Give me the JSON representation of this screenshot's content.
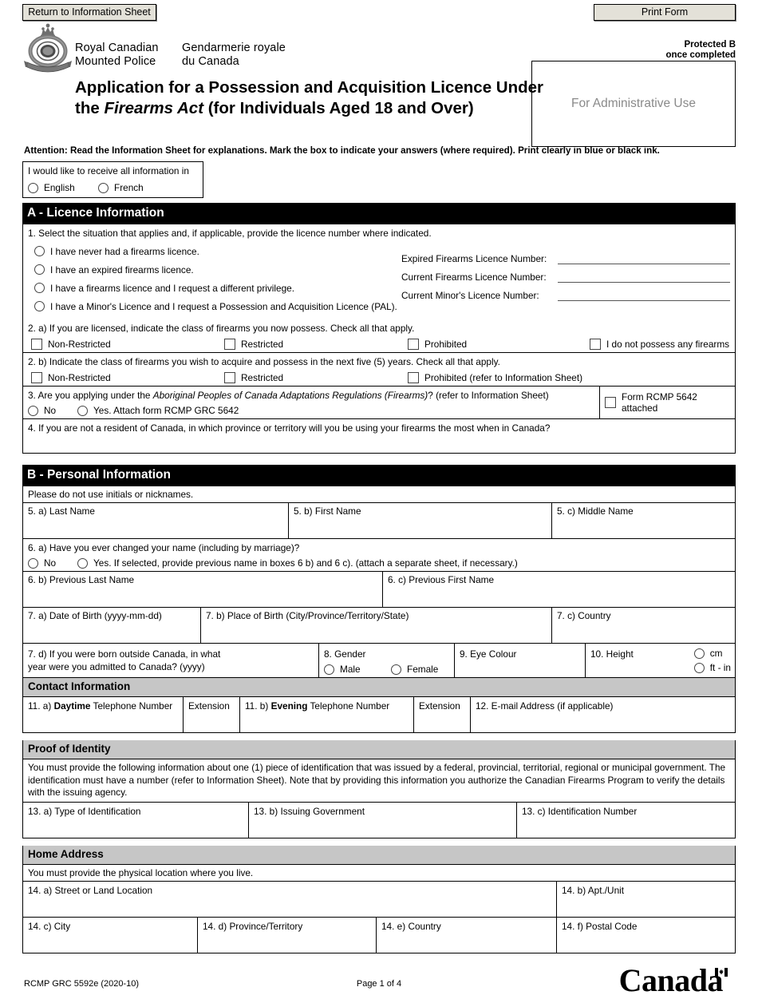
{
  "buttons": {
    "return_label": "Return to Information Sheet",
    "print_label": "Print Form"
  },
  "header": {
    "org_en_line1": "Royal Canadian",
    "org_en_line2": "Mounted Police",
    "org_fr_line1": "Gendarmerie royale",
    "org_fr_line2": "du Canada",
    "title_part1": "Application for a Possession and Acquisition Licence Under the ",
    "title_italic": "Firearms Act",
    "title_part2": " (for Individuals Aged 18 and Over)",
    "protected_line1": "Protected B",
    "protected_line2": "once completed",
    "admin_use": "For Administrative Use"
  },
  "attention": "Attention: Read the Information Sheet for explanations. Mark the box to indicate your answers (where required). Print clearly in blue or black ink.",
  "language": {
    "prompt": "I would like to receive all information in",
    "option_english": "English",
    "option_french": "French"
  },
  "section_a": {
    "heading": "A - Licence Information",
    "q1": {
      "lead": "1. Select the situation that applies and, if applicable, provide the licence number where indicated.",
      "choices": [
        "I have never had a firearms licence.",
        "I have an expired firearms licence.",
        "I have a firearms licence and I request a different privilege.",
        "I have a Minor's Licence and I request a Possession and Acquisition Licence (PAL)."
      ],
      "number_labels": [
        "Expired Firearms Licence Number:",
        "Current Firearms Licence Number:",
        "Current Minor's Licence Number:"
      ]
    },
    "q2a": {
      "lead": "2. a) If you are licensed, indicate the class of firearms you now possess. Check all that apply.",
      "options": [
        "Non-Restricted",
        "Restricted",
        "Prohibited",
        "I do not possess any firearms"
      ]
    },
    "q2b": {
      "lead": "2. b) Indicate the class of firearms you wish to acquire and possess in the next five (5) years. Check all that apply.",
      "options": [
        "Non-Restricted",
        "Restricted",
        "Prohibited (refer to Information Sheet)"
      ]
    },
    "q3": {
      "lead_part1": "3. Are you applying under the ",
      "lead_italic": "Aboriginal Peoples of Canada Adaptations Regulations (Firearms)",
      "lead_part2": "? (refer to Information Sheet)",
      "option_no": "No",
      "option_yes": "Yes. Attach form RCMP GRC 5642",
      "attach_label": "Form RCMP 5642 attached"
    },
    "q4": {
      "lead": "4. If you are not a resident of Canada, in which province or territory will you be using your firearms the most when in Canada?"
    }
  },
  "section_b": {
    "heading": "B - Personal Information",
    "note_initials": "Please do not use initials or nicknames.",
    "q5a": "5. a) Last Name",
    "q5b": "5. b) First Name",
    "q5c": "5. c) Middle Name",
    "q6a": {
      "lead": "6. a) Have you ever changed your name (including by marriage)?",
      "option_no": "No",
      "option_yes": "Yes. If selected, provide previous name in boxes 6 b) and 6 c). (attach a separate sheet, if necessary.)"
    },
    "q6b": "6. b) Previous Last Name",
    "q6c": "6. c) Previous First Name",
    "q7a": "7. a) Date of Birth (yyyy-mm-dd)",
    "q7b": "7. b) Place of Birth (City/Province/Territory/State)",
    "q7c": "7. c) Country",
    "q7d_line1": "7. d) If you were born outside Canada, in what",
    "q7d_line2": "year were you admitted to Canada? (yyyy)",
    "q8": {
      "label": "8. Gender",
      "option_male": "Male",
      "option_female": "Female"
    },
    "q9": "9. Eye Colour",
    "q10": {
      "label": "10. Height",
      "unit_cm": "cm",
      "unit_ftin": "ft - in"
    },
    "contact_heading": "Contact Information",
    "q11a_bold": "Daytime",
    "q11a_pre": "11. a) ",
    "q11a_post": " Telephone Number",
    "q11b_bold": "Evening",
    "q11b_pre": "11. b) ",
    "q11b_post": " Telephone Number",
    "extension_label": "Extension",
    "q12": "12. E-mail Address (if applicable)",
    "identity_heading": "Proof of Identity",
    "identity_note": "You must provide the following information about one (1) piece of identification that was issued by a federal, provincial, territorial, regional or municipal government. The identification must have a number (refer to Information Sheet). Note that by providing this information you authorize the Canadian Firearms Program to verify the details with the issuing agency.",
    "q13a": "13. a) Type of Identification",
    "q13b": "13. b) Issuing Government",
    "q13c": "13. c) Identification Number",
    "address_heading": "Home Address",
    "address_note": "You must provide the physical location where you live.",
    "q14a": "14. a) Street or Land Location",
    "q14b": "14. b) Apt./Unit",
    "q14c": "14. c) City",
    "q14d": "14. d) Province/Territory",
    "q14e": "14. e) Country",
    "q14f": "14. f) Postal Code"
  },
  "footer": {
    "form_number": "RCMP GRC 5592e (2020-10)",
    "page": "Page 1 of 4",
    "wordmark": "Canada"
  }
}
